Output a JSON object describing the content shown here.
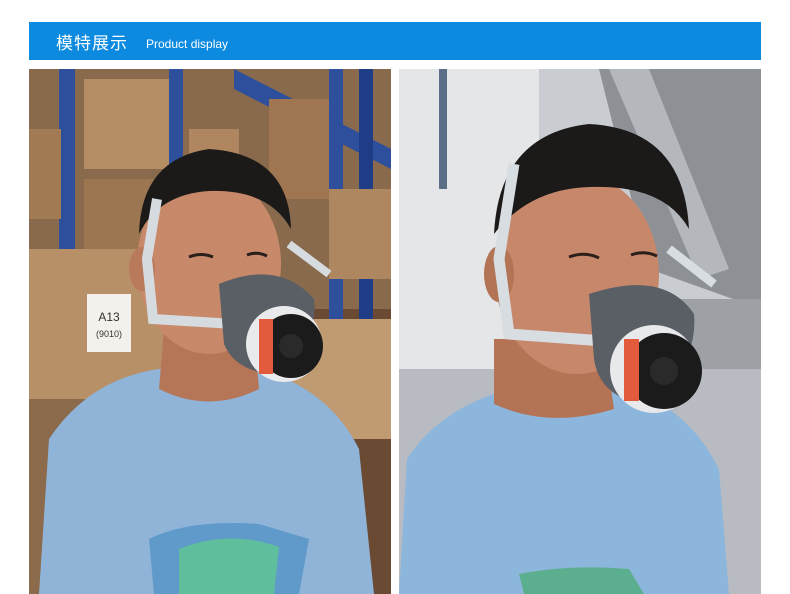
{
  "header": {
    "title_cn": "模特展示",
    "title_en": "Product display",
    "bg_color": "#0b8ae0"
  },
  "photos": [
    {
      "name": "model-front-view",
      "box_label": "A13",
      "box_sublabel": "(9010)"
    },
    {
      "name": "model-side-view"
    }
  ]
}
